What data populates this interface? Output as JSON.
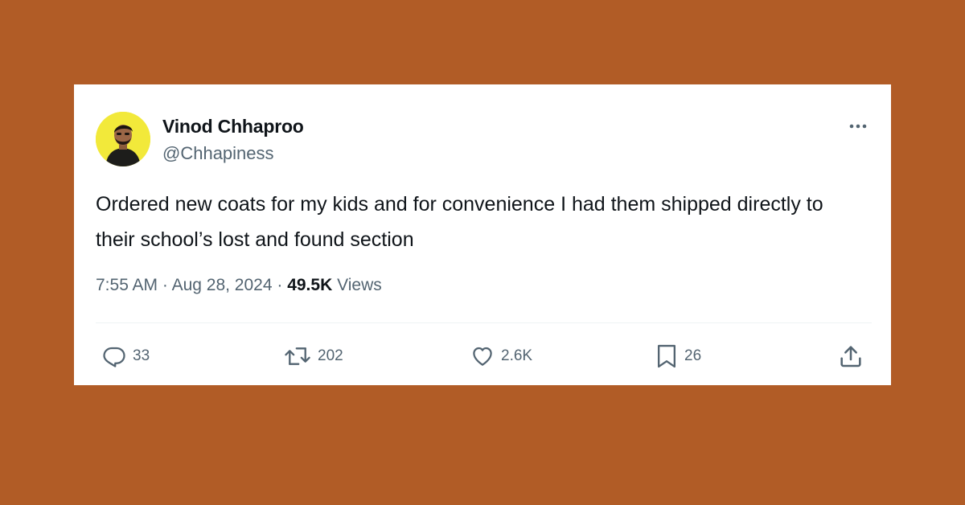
{
  "author": {
    "name": "Vinod Chhaproo",
    "handle": "@Chhapiness"
  },
  "tweet": {
    "text": "Ordered new coats for my kids and for convenience I had them shipped directly to their school’s lost and found section",
    "time": "7:55 AM",
    "date": "Aug 28, 2024",
    "views_count": "49.5K",
    "views_label": "Views"
  },
  "actions": {
    "replies": "33",
    "reposts": "202",
    "likes": "2.6K",
    "bookmarks": "26"
  },
  "colors": {
    "background": "#b15c26",
    "card": "#ffffff",
    "primary_text": "#0f1419",
    "secondary_text": "#536471",
    "avatar_bg": "#f2e93a"
  },
  "icons": {
    "more": "more-horizontal-icon",
    "reply": "reply-icon",
    "repost": "repost-icon",
    "like": "heart-icon",
    "bookmark": "bookmark-icon",
    "share": "share-icon"
  }
}
